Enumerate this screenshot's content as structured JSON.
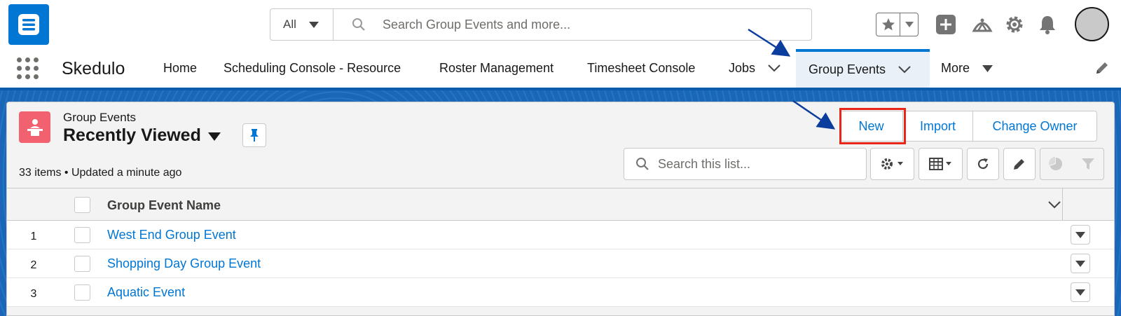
{
  "header": {
    "search_scope": "All",
    "search_placeholder": "Search Group Events and more..."
  },
  "nav": {
    "app_name": "Skedulo",
    "items": [
      {
        "label": "Home"
      },
      {
        "label": "Scheduling Console - Resource"
      },
      {
        "label": "Roster Management"
      },
      {
        "label": "Timesheet Console"
      },
      {
        "label": "Jobs"
      },
      {
        "label": "Group Events"
      },
      {
        "label": "More"
      }
    ],
    "active": "Group Events"
  },
  "list": {
    "object_label": "Group Events",
    "view_name": "Recently Viewed",
    "meta": "33 items • Updated a minute ago",
    "actions": {
      "new": "New",
      "import": "Import",
      "change_owner": "Change Owner"
    },
    "search_placeholder": "Search this list...",
    "column": "Group Event Name",
    "rows": [
      {
        "num": "1",
        "name": "West End Group Event"
      },
      {
        "num": "2",
        "name": "Shopping Day Group Event"
      },
      {
        "num": "3",
        "name": "Aquatic Event"
      }
    ]
  },
  "colors": {
    "brand": "#0176d3",
    "object_icon": "#f2616f",
    "highlight": "#e8261a",
    "annotation_arrow": "#0b3d9e"
  },
  "icons": [
    "app-logo-icon",
    "search-icon",
    "star-icon",
    "plus-icon",
    "trailhead-icon",
    "gear-icon",
    "bell-icon",
    "waffle-icon",
    "pencil-icon",
    "event-icon",
    "pin-icon",
    "refresh-icon",
    "table-icon",
    "chart-icon",
    "filter-icon"
  ]
}
